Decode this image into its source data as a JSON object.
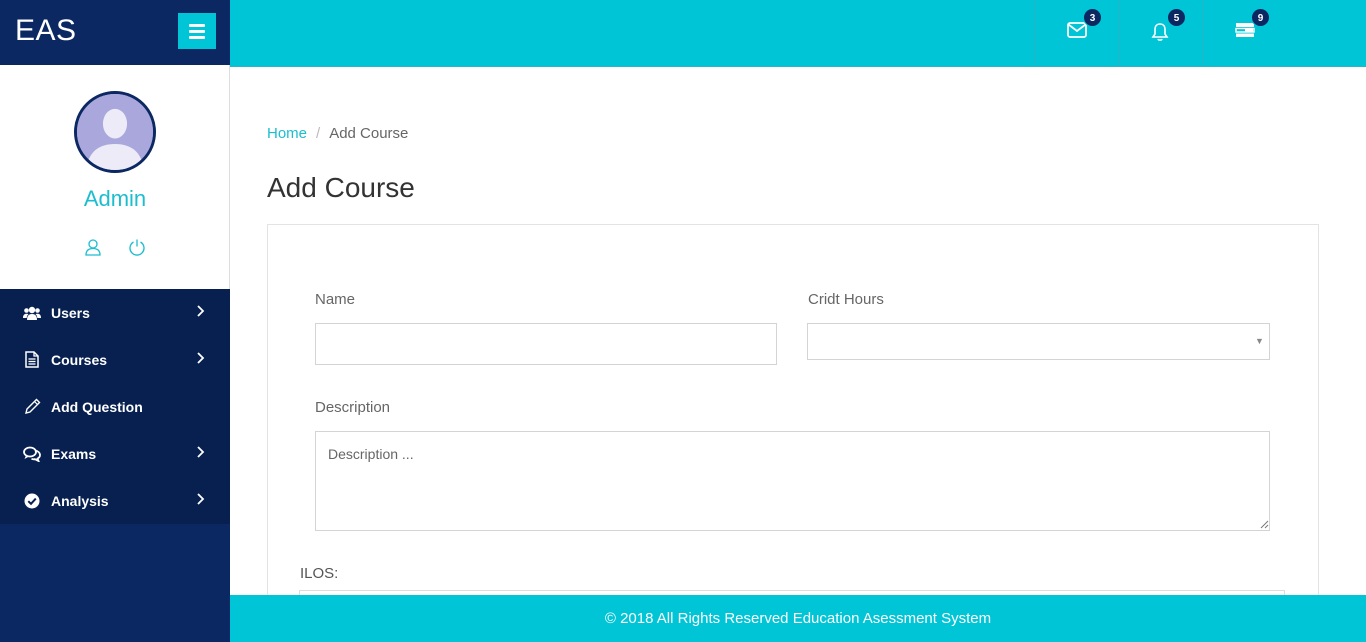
{
  "brand": {
    "title": "EAS"
  },
  "profile": {
    "name": "Admin"
  },
  "menu": {
    "items": [
      {
        "label": "Users",
        "icon": "users-icon",
        "has_children": true
      },
      {
        "label": "Courses",
        "icon": "file-icon",
        "has_children": true
      },
      {
        "label": "Add Question",
        "icon": "pencil-icon",
        "has_children": false
      },
      {
        "label": "Exams",
        "icon": "comments-icon",
        "has_children": true
      },
      {
        "label": "Analysis",
        "icon": "check-circle-icon",
        "has_children": true
      }
    ]
  },
  "topbar": {
    "messages_count": "3",
    "notifications_count": "5",
    "tasks_count": "9"
  },
  "breadcrumb": {
    "home": "Home",
    "separator": "/",
    "current": "Add Course"
  },
  "page": {
    "title": "Add Course"
  },
  "form": {
    "name_label": "Name",
    "name_value": "",
    "credit_hours_label": "Cridt Hours",
    "credit_hours_value": "",
    "description_label": "Description",
    "description_placeholder": "Description ...",
    "ilos_label": "ILOS:"
  },
  "footer": {
    "text": "© 2018 All Rights Reserved Education Asessment System"
  },
  "colors": {
    "primary_dark": "#0b2862",
    "accent": "#00c5d6",
    "accent_text": "#1cbdcf"
  }
}
